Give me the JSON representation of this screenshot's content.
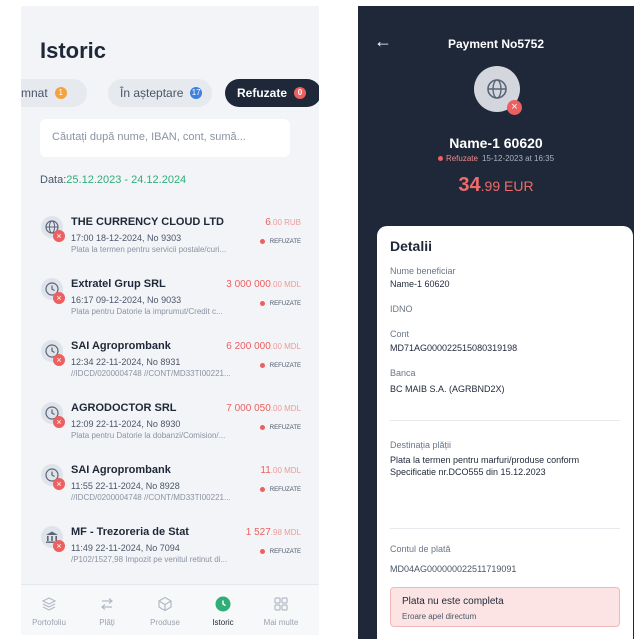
{
  "history": {
    "title": "Istoric",
    "tabs": [
      {
        "label": "mnat",
        "count": "1",
        "color": "#f3a23c"
      },
      {
        "label": "În așteptare",
        "count": "17",
        "color": "#3f7fe0"
      },
      {
        "label": "Refuzate",
        "count": "0",
        "color": "#ee5f5f",
        "active": true
      }
    ],
    "search_placeholder": "Căutați după nume, IBAN, cont, sumă...",
    "date_label": "Data:",
    "date_range": "25.12.2023 - 24.12.2024",
    "status_label": "REFUZATE",
    "transactions": [
      {
        "name": "THE CURRENCY CLOUD LTD",
        "meta": "17:00 18-12-2024, No 9303",
        "desc": "Plata la termen pentru servicii postale/curi...",
        "amount_int": "6",
        "amount_rest": ".00 RUB",
        "icon": "globe-icon"
      },
      {
        "name": "Extratel Grup SRL",
        "meta": "16:17 09-12-2024, No 9033",
        "desc": "Plata pentru Datorie la imprumut/Credit c...",
        "amount_int": "3 000 000",
        "amount_rest": ".00 MDL",
        "icon": "clock-icon"
      },
      {
        "name": "SAI Agroprombank",
        "meta": "12:34 22-11-2024, No 8931",
        "desc": "//IDCD/0200004748 //CONT/MD33TI00221...",
        "amount_int": "6 200 000",
        "amount_rest": ".00 MDL",
        "icon": "clock-icon"
      },
      {
        "name": "AGRODOCTOR SRL",
        "meta": "12:09 22-11-2024, No 8930",
        "desc": "Plata pentru Datorie la dobanzi/Comision/...",
        "amount_int": "7 000 050",
        "amount_rest": ".00 MDL",
        "icon": "clock-icon"
      },
      {
        "name": "SAI Agroprombank",
        "meta": "11:55 22-11-2024, No 8928",
        "desc": "//IDCD/0200004748 //CONT/MD33TI00221...",
        "amount_int": "11",
        "amount_rest": ".00 MDL",
        "icon": "clock-icon"
      },
      {
        "name": "MF - Trezoreria de Stat",
        "meta": "11:49 22-11-2024, No 7094",
        "desc": "/P102/1527,98 Impozit pe venitul retinut di...",
        "amount_int": "1 527",
        "amount_rest": ".98 MDL",
        "icon": "bank-icon"
      }
    ],
    "nav": [
      {
        "label": "Portofoliu",
        "icon": "layers-icon"
      },
      {
        "label": "Plăți",
        "icon": "transfer-icon"
      },
      {
        "label": "Produse",
        "icon": "cube-icon"
      },
      {
        "label": "Istoric",
        "icon": "history-icon",
        "active": true
      },
      {
        "label": "Mai multe",
        "icon": "grid-icon"
      }
    ]
  },
  "payment": {
    "back_icon": "arrow-left-icon",
    "title": "Payment No5752",
    "name": "Name-1 60620",
    "status": "Refuzate",
    "datetime": "15-12-2023 at 16:35",
    "amount_int": "34",
    "amount_rest": ".99 EUR",
    "details_title": "Detalii",
    "fields": {
      "beneficiar_label": "Nume beneficiar",
      "beneficiar_value": "Name-1 60620",
      "idno_label": "IDNO",
      "cont_label": "Cont",
      "cont_value": "MD71AG000022515080319198",
      "banca_label": "Banca",
      "banca_value": "BC MAIB S.A. (AGRBND2X)",
      "destinatia_label": "Destinația plății",
      "destinatia_value": "Plata la termen pentru marfuri/produse conform Specificatie nr.DCO555 din 15.12.2023",
      "contul_label": "Contul de plată",
      "contul_value": "MD04AG000000022511719091"
    },
    "error_title": "Plata nu este completa",
    "error_subtitle": "Eroare apel directum"
  }
}
